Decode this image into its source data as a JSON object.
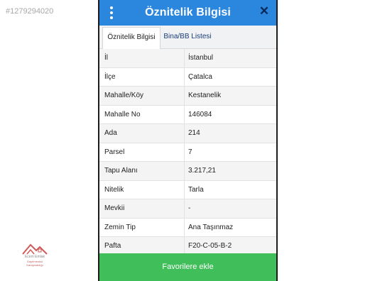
{
  "listing_id": "#1279294020",
  "header": {
    "title": "Öznitelik Bilgisi",
    "menu_icon": "more-vertical-icon",
    "close_icon": "close-icon",
    "close_glyph": "✕",
    "accent": "#2b86dd"
  },
  "tabs": [
    {
      "label": "Öznitelik Bilgisi",
      "active": true
    },
    {
      "label": "Bina/BB Listesi",
      "active": false
    }
  ],
  "attributes": [
    {
      "label": "İl",
      "value": "İstanbul"
    },
    {
      "label": "İlçe",
      "value": "Çatalca"
    },
    {
      "label": "Mahalle/Köy",
      "value": "Kestanelik"
    },
    {
      "label": "Mahalle No",
      "value": "146084"
    },
    {
      "label": "Ada",
      "value": "214"
    },
    {
      "label": "Parsel",
      "value": "7"
    },
    {
      "label": "Tapu Alanı",
      "value": "3.217,21"
    },
    {
      "label": "Nitelik",
      "value": "Tarla"
    },
    {
      "label": "Mevkii",
      "value": "-"
    },
    {
      "label": "Zemin Tip",
      "value": "Ana Taşınmaz"
    },
    {
      "label": "Pafta",
      "value": "F20-C-05-B-2"
    }
  ],
  "favorite_button": {
    "label": "Favorilere ekle",
    "color": "#3fbe59"
  },
  "watermark": {
    "name": "Ecem Emlak",
    "tagline": "Gayrimenkul Danışmanlığı",
    "icon": "house-logo-icon"
  }
}
